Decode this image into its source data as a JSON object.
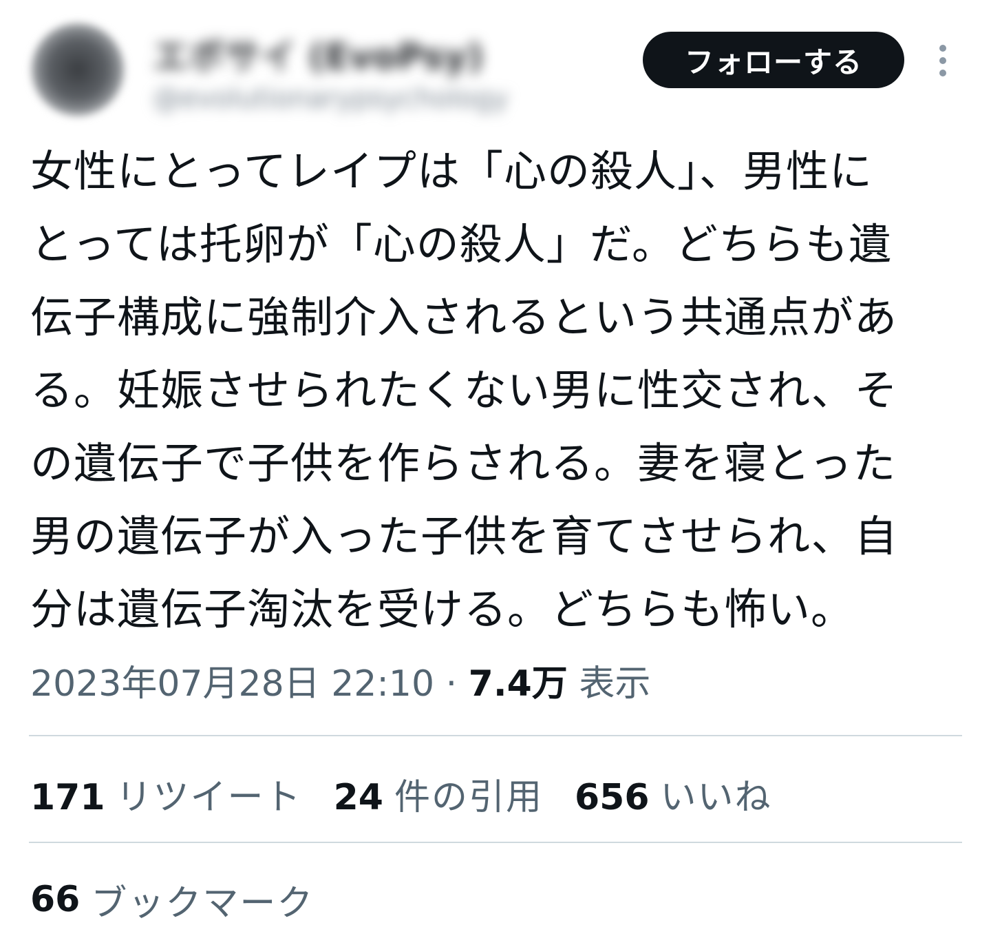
{
  "author": {
    "display_name": "エボサイ (EvoPsy)",
    "handle": "@evolutionarypsychology"
  },
  "follow_button": {
    "label": "フォローする"
  },
  "more_menu": {
    "icon": "more-vertical-icon"
  },
  "tweet": {
    "text": "女性にとってレイプは「心の殺人」、男性にとっては托卵が「心の殺人」だ。どちらも遺伝子構成に強制介入されるという共通点がある。妊娠させられたくない男に性交され、その遺伝子で子供を作らされる。妻を寝とった男の遺伝子が入った子供を育てさせられ、自分は遺伝子淘汰を受ける。どちらも怖い。",
    "lines": [
      "女性にとってレイプは「心の殺人」、男性に",
      "とっては托卵が「心の殺人」だ。どちらも遺",
      "伝子構成に強制介入されるという共通点があ",
      "る。妊娠させられたくない男に性交され、そ",
      "の遺伝子で子供を作らされる。妻を寝とった",
      "男の遺伝子が入った子供を育てさせられ、自",
      "分は遺伝子淘汰を受ける。どちらも怖い。"
    ]
  },
  "meta": {
    "timestamp": "2023年07月28日 22:10",
    "separator": "·",
    "views_count": "7.4万",
    "views_label": "表示"
  },
  "stats": {
    "retweets": {
      "count": "171",
      "label": "リツイート"
    },
    "quotes": {
      "count": "24",
      "label": "件の引用"
    },
    "likes": {
      "count": "656",
      "label": "いいね"
    },
    "bookmarks": {
      "count": "66",
      "label": "ブックマーク"
    }
  },
  "colors": {
    "text_primary": "#0f1419",
    "text_secondary": "#536471",
    "divider": "#cfd9de",
    "button_bg": "#0f1419",
    "button_text": "#ffffff"
  }
}
